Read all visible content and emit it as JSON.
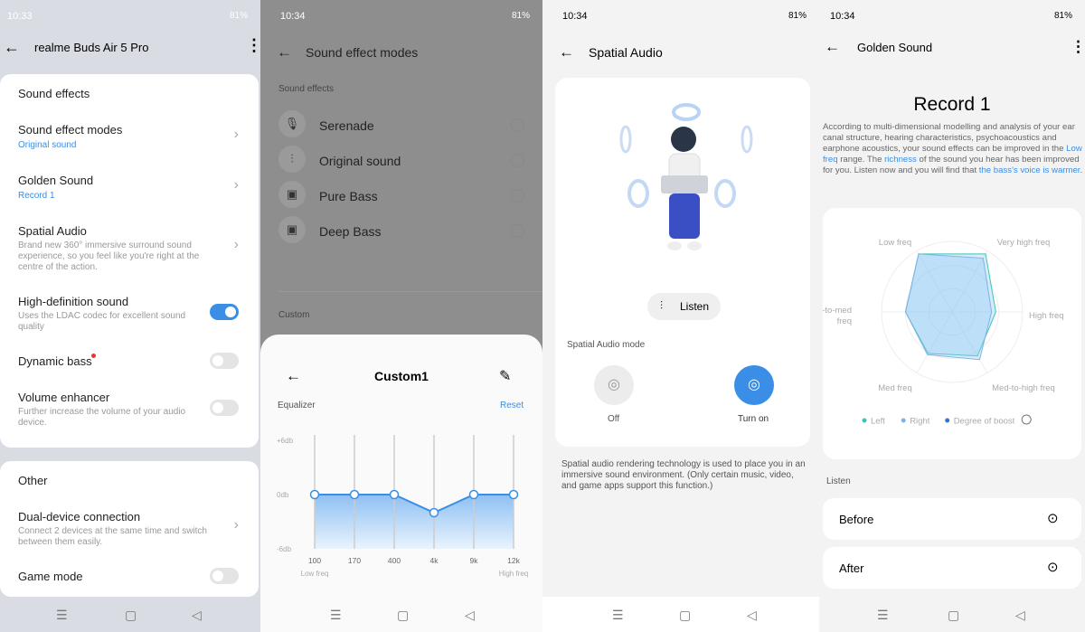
{
  "status": [
    {
      "time": "10:33",
      "battery": "81%"
    },
    {
      "time": "10:34",
      "battery": "81%"
    },
    {
      "time": "10:34",
      "battery": "81%"
    },
    {
      "time": "10:34",
      "battery": "81%"
    }
  ],
  "p1": {
    "title": "realme Buds Air 5 Pro",
    "section1": "Sound effects",
    "items": [
      {
        "label": "Sound effect modes",
        "value": "Original sound"
      },
      {
        "label": "Golden Sound",
        "value": "Record 1"
      },
      {
        "label": "Spatial Audio",
        "desc": "Brand new 360° immersive surround sound experience, so you feel like you're right at the centre of the action."
      },
      {
        "label": "High-definition sound",
        "desc": "Uses the LDAC codec for excellent sound quality",
        "on": true
      },
      {
        "label": "Dynamic bass",
        "on": false
      },
      {
        "label": "Volume enhancer",
        "desc": "Further increase the volume of your audio device.",
        "on": false
      }
    ],
    "section2": "Other",
    "other": [
      {
        "label": "Dual-device connection",
        "desc": "Connect 2 devices at the same time and switch between them easily."
      },
      {
        "label": "Game mode",
        "on": false
      }
    ]
  },
  "p2": {
    "title": "Sound effect modes",
    "section": "Sound effects",
    "modes": [
      {
        "label": "Serenade",
        "icon": "microphone-icon"
      },
      {
        "label": "Original sound",
        "icon": "sliders-icon"
      },
      {
        "label": "Pure Bass",
        "icon": "speaker-icon"
      },
      {
        "label": "Deep Bass",
        "icon": "speaker-icon"
      }
    ],
    "custom": "Custom",
    "sheet": {
      "title": "Custom1",
      "equalizer": "Equalizer",
      "reset": "Reset"
    }
  },
  "chart_data": [
    {
      "type": "line",
      "title": "Equalizer",
      "categories": [
        "100",
        "170",
        "400",
        "4k",
        "9k",
        "12k"
      ],
      "values": [
        0,
        0,
        0,
        -2,
        0,
        0
      ],
      "ylim": [
        -6,
        6
      ],
      "yticks": [
        "+6db",
        "0db",
        "-6db"
      ],
      "xlabel_left": "Low freq",
      "xlabel_right": "High freq"
    },
    {
      "type": "radar",
      "axes": [
        "Low freq",
        "Very high freq",
        "High freq",
        "Med-to-high freq",
        "Med freq",
        "Low-to-med freq"
      ],
      "series": [
        {
          "name": "Left",
          "values": [
            0.95,
            0.95,
            0.62,
            0.72,
            0.68,
            0.66
          ],
          "color": "#3cc6b0"
        },
        {
          "name": "Right",
          "values": [
            0.95,
            0.88,
            0.56,
            0.78,
            0.7,
            0.66
          ],
          "color": "#7fb2ea"
        },
        {
          "name": "Degree of boost",
          "color": "#2f78d4"
        }
      ],
      "range": [
        0,
        1
      ]
    }
  ],
  "p3": {
    "title": "Spatial Audio",
    "listen": "Listen",
    "mode_label": "Spatial Audio mode",
    "off": "Off",
    "on": "Turn on",
    "desc": "Spatial audio rendering technology is used to place you in an immersive sound environment. (Only certain music, video, and game apps support this function.)"
  },
  "p4": {
    "title": "Golden Sound",
    "record": "Record 1",
    "d1": "According to multi-dimensional modelling and analysis of your ear canal structure, hearing characteristics, psychoacoustics and earphone acoustics, your sound effects can be improved in the ",
    "h1": "Low freq",
    "d2": " range. The ",
    "h2": "richness",
    "d3": " of the sound you hear has been improved for you. Listen now and you will find that ",
    "h3": "the bass's voice is warmer",
    "d4": ".",
    "listen": "Listen",
    "before": "Before",
    "after": "After"
  },
  "colors": {
    "accent": "#3a8ee6"
  }
}
